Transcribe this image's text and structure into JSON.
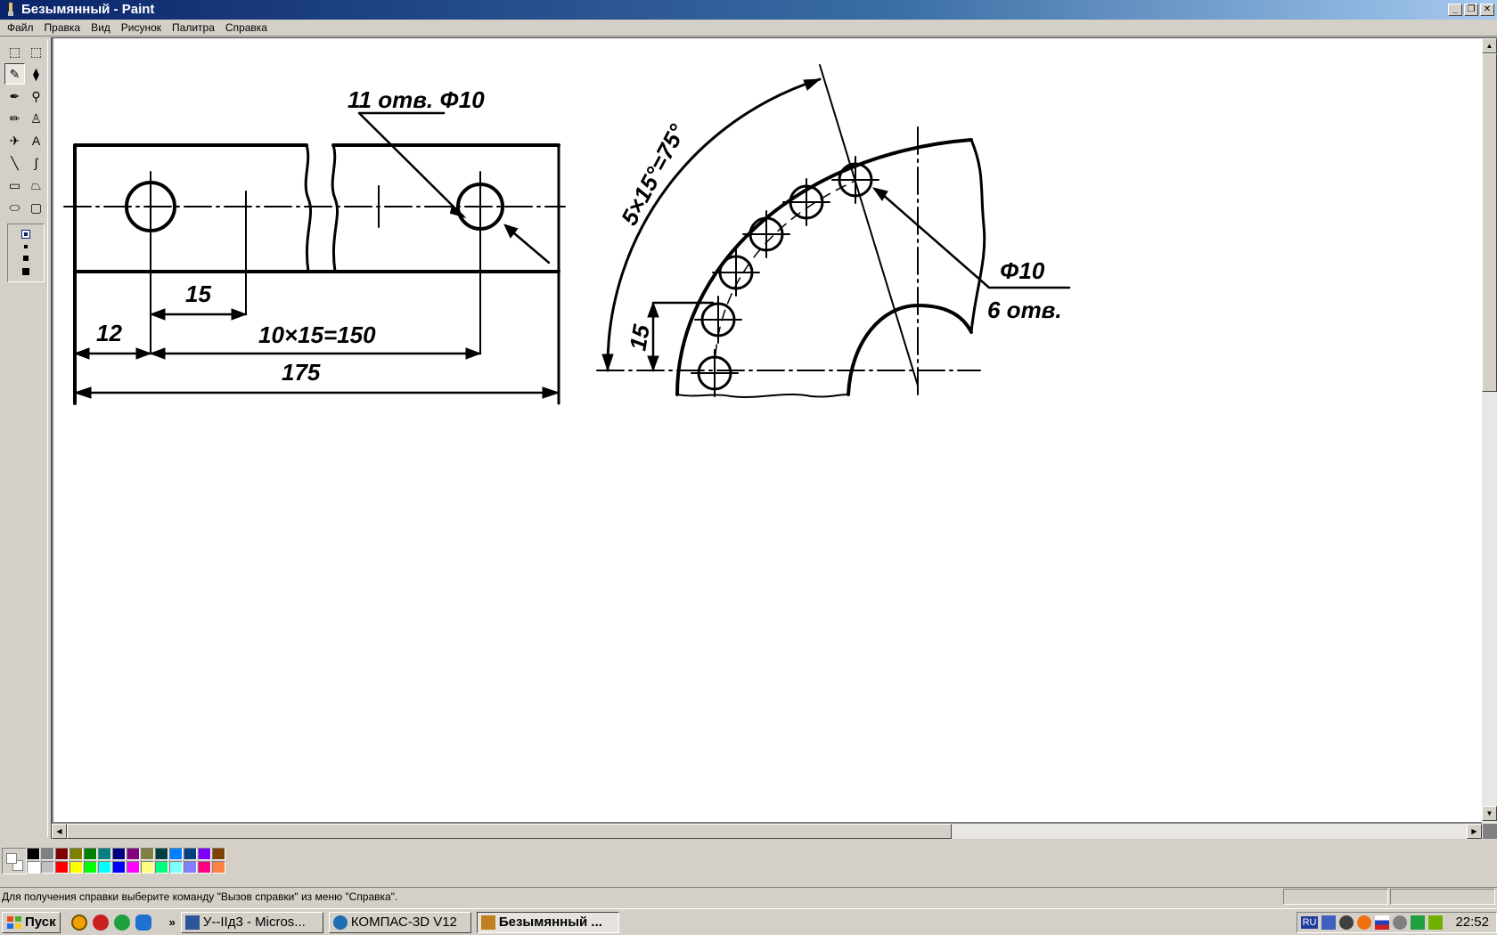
{
  "window": {
    "title": "Безымянный - Paint"
  },
  "menu": [
    "Файл",
    "Правка",
    "Вид",
    "Рисунок",
    "Палитра",
    "Справка"
  ],
  "tools": [
    {
      "name": "free-form-select-tool",
      "glyph": "⬚"
    },
    {
      "name": "rect-select-tool",
      "glyph": "⬚"
    },
    {
      "name": "eraser-tool",
      "glyph": "✎"
    },
    {
      "name": "fill-tool",
      "glyph": "⧫"
    },
    {
      "name": "color-picker-tool",
      "glyph": "✒"
    },
    {
      "name": "magnifier-tool",
      "glyph": "⚲"
    },
    {
      "name": "pencil-tool",
      "glyph": "✏"
    },
    {
      "name": "brush-tool",
      "glyph": "♙"
    },
    {
      "name": "airbrush-tool",
      "glyph": "✈"
    },
    {
      "name": "text-tool",
      "glyph": "A"
    },
    {
      "name": "line-tool",
      "glyph": "╲"
    },
    {
      "name": "curve-tool",
      "glyph": "∫"
    },
    {
      "name": "rectangle-tool",
      "glyph": "▭"
    },
    {
      "name": "polygon-tool",
      "glyph": "⏢"
    },
    {
      "name": "ellipse-tool",
      "glyph": "⬭"
    },
    {
      "name": "rounded-rect-tool",
      "glyph": "▢"
    }
  ],
  "drawing": {
    "left_labels": {
      "holes": "11 отв. Φ10",
      "d15": "15",
      "d12": "12",
      "pitch": "10×15=150",
      "total": "175"
    },
    "right_labels": {
      "arc": "5×15°=75°",
      "d15": "15",
      "dia": "Φ10",
      "holes": "6 отв."
    }
  },
  "palette": {
    "top": [
      "#000000",
      "#808080",
      "#800000",
      "#808000",
      "#008000",
      "#008080",
      "#000080",
      "#800080",
      "#808040",
      "#004040",
      "#0080ff",
      "#004080",
      "#8000ff",
      "#804000"
    ],
    "bottom": [
      "#ffffff",
      "#c0c0c0",
      "#ff0000",
      "#ffff00",
      "#00ff00",
      "#00ffff",
      "#0000ff",
      "#ff00ff",
      "#ffff80",
      "#00ff80",
      "#80ffff",
      "#8080ff",
      "#ff0080",
      "#ff8040"
    ]
  },
  "status": {
    "text": "Для получения справки выберите команду \"Вызов справки\" из меню \"Справка\"."
  },
  "taskbar": {
    "start": "Пуск",
    "tasks": [
      {
        "label": "У--IIд3 - Micros...",
        "color": "#2b579a"
      },
      {
        "label": "КОМПАС-3D V12",
        "color": "#1f6fb2"
      },
      {
        "label": "Безымянный ...",
        "color": "#c08020"
      }
    ],
    "clock": "22:52",
    "lang": "RU"
  }
}
